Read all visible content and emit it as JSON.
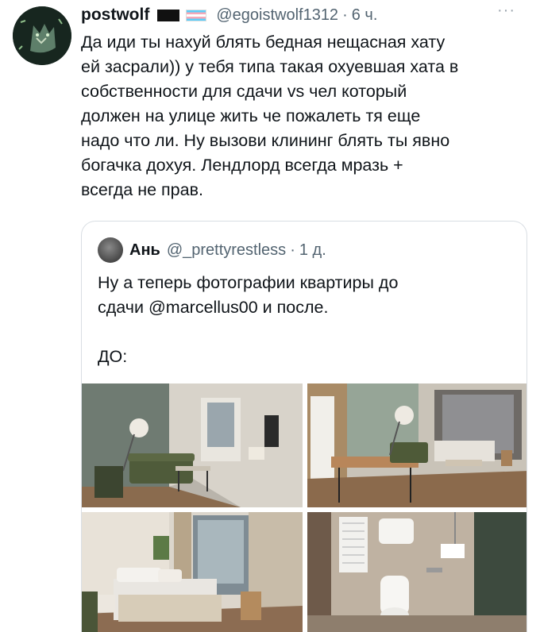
{
  "tweet": {
    "author_name": "postwolf",
    "author_handle": "@egoistwolf1312",
    "separator": "·",
    "time": "6 ч.",
    "more_label": "···",
    "text": "Да иди ты нахуй блять бедная нещасная хату\nей засрали)) у тебя типа такая охуевшая хата в\nсобственности для сдачи vs чел который\nдолжен на улице жить че пожалеть тя еще\nнадо что ли. Ну вызови клининг блять ты явно\nбогачка дохуя. Лендлорд всегда мразь +\nвсегда не прав."
  },
  "quoted": {
    "author_name": "Ань",
    "author_handle": "@_prettyrestless",
    "separator": "·",
    "time": "1 д.",
    "text": "Ну а теперь фотографии квартиры до\nсдачи @marcellus00 и после.\n\nДО:"
  },
  "photos": [
    {
      "subject": "living-room"
    },
    {
      "subject": "studio-dining-area"
    },
    {
      "subject": "bedroom"
    },
    {
      "subject": "bathroom"
    }
  ],
  "icons": {
    "flags": [
      "black-flag-icon",
      "trans-flag-icon"
    ],
    "more": "more-options-icon"
  }
}
